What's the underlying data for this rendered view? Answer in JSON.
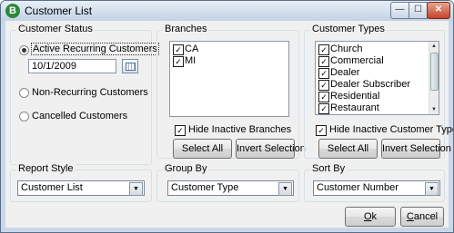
{
  "window": {
    "title": "Customer List",
    "icon_letter": "B",
    "min_glyph": "—",
    "max_glyph": "☐",
    "close_glyph": "✕"
  },
  "customer_status": {
    "legend": "Customer Status",
    "active_label": "Active Recurring Customers",
    "active_date": "10/1/2009",
    "nonrecurring_label": "Non-Recurring Customers",
    "cancelled_label": "Cancelled Customers",
    "selected": "active"
  },
  "branches": {
    "legend": "Branches",
    "items": [
      {
        "label": "CA",
        "checked": true
      },
      {
        "label": "MI",
        "checked": true
      }
    ],
    "hide_inactive_label": "Hide Inactive Branches",
    "hide_inactive_checked": true,
    "select_all": "Select All",
    "invert": "Invert Selection"
  },
  "customer_types": {
    "legend": "Customer Types",
    "items": [
      {
        "label": "Church",
        "checked": true
      },
      {
        "label": "Commercial",
        "checked": true
      },
      {
        "label": "Dealer",
        "checked": true
      },
      {
        "label": "Dealer Subscriber",
        "checked": true
      },
      {
        "label": "Residential",
        "checked": true
      },
      {
        "label": "Restaurant",
        "checked": true
      }
    ],
    "hide_inactive_label": "Hide Inactive Customer Types",
    "hide_inactive_checked": true,
    "select_all": "Select All",
    "invert": "Invert Selection"
  },
  "report_style": {
    "legend": "Report Style",
    "value": "Customer List"
  },
  "group_by": {
    "legend": "Group By",
    "value": "Customer Type"
  },
  "sort_by": {
    "legend": "Sort By",
    "value": "Customer Number"
  },
  "actions": {
    "ok_mnemonic": "O",
    "ok_rest": "k",
    "cancel_mnemonic": "C",
    "cancel_rest": "ancel"
  },
  "glyphs": {
    "check": "✓",
    "dropdown": "▼",
    "scroll_up": "▲",
    "scroll_down": "▼"
  }
}
